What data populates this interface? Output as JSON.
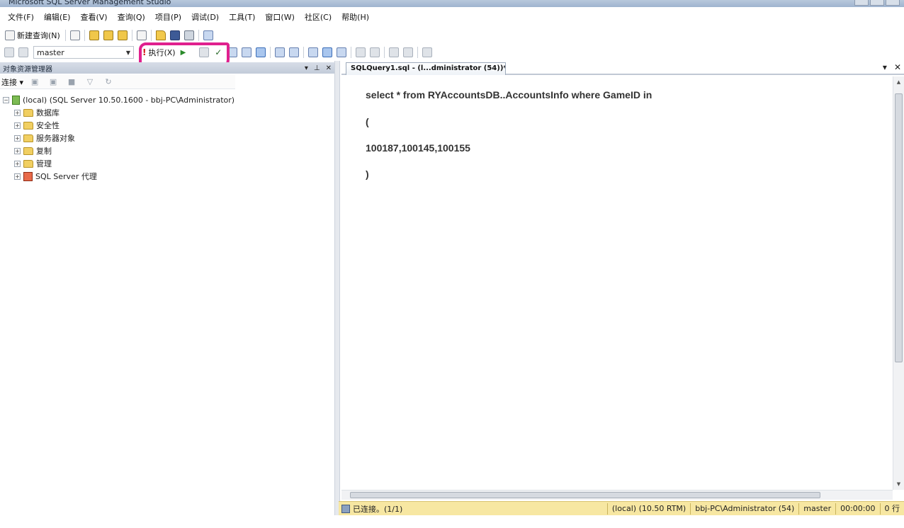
{
  "window": {
    "title": "Microsoft SQL Server Management Studio"
  },
  "menu": [
    {
      "label": "文件(F)"
    },
    {
      "label": "编辑(E)"
    },
    {
      "label": "查看(V)"
    },
    {
      "label": "查询(Q)"
    },
    {
      "label": "项目(P)"
    },
    {
      "label": "调试(D)"
    },
    {
      "label": "工具(T)"
    },
    {
      "label": "窗口(W)"
    },
    {
      "label": "社区(C)"
    },
    {
      "label": "帮助(H)"
    }
  ],
  "toolbar": {
    "new_query_label": "新建查询(N)",
    "database": "master",
    "execute_label": "执行(X)"
  },
  "object_explorer": {
    "title": "对象资源管理器",
    "connect_label": "连接",
    "server_node": "(local) (SQL Server 10.50.1600 - bbj-PC\\Administrator)",
    "children": [
      {
        "label": "数据库"
      },
      {
        "label": "安全性"
      },
      {
        "label": "服务器对象"
      },
      {
        "label": "复制"
      },
      {
        "label": "管理"
      },
      {
        "label": "SQL Server 代理"
      }
    ]
  },
  "editor": {
    "tab_label": "SQLQuery1.sql - (l...dministrator (54))*",
    "lines": [
      "select * from RYAccountsDB..AccountsInfo where GameID in",
      "(",
      "100187,100145,100155",
      ")"
    ]
  },
  "statusbar": {
    "connected": "已连接。(1/1)",
    "server": "(local) (10.50 RTM)",
    "user": "bbj-PC\\Administrator (54)",
    "database": "master",
    "elapsed": "00:00:00",
    "rows": "0 行"
  },
  "colors": {
    "highlight": "#e0208e",
    "statusbar": "#f7e7a2"
  }
}
